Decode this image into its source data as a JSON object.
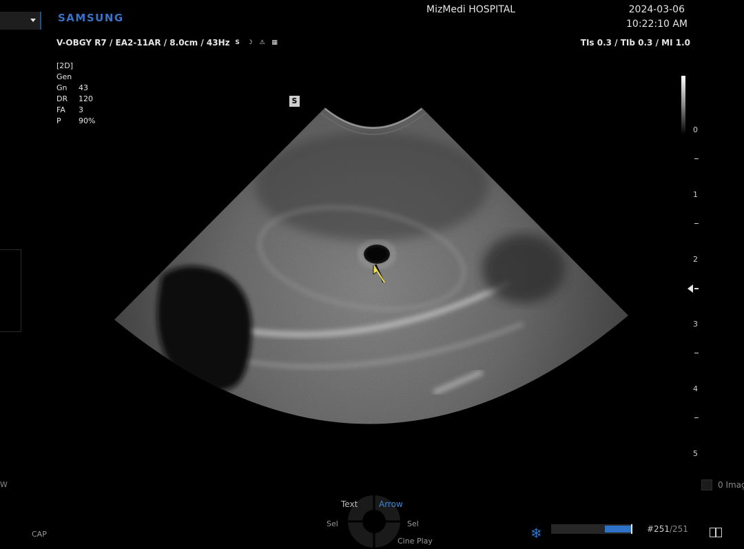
{
  "header": {
    "brand": "SAMSUNG",
    "hospital": "MizMedi HOSPITAL",
    "date": "2024-03-06",
    "time": "10:22:10 AM",
    "probe_info": "V-OBGY R7 / EA2-11AR / 8.0cm / 43Hz",
    "safety_info": "TIs  0.3 / TIb  0.3 / MI    1.0",
    "status_icons": [
      "s-mark-icon",
      "fetus-icon",
      "warning-icon",
      "chart-icon"
    ]
  },
  "params": {
    "mode": "[2D]",
    "preset": "Gen",
    "rows": [
      {
        "key": "Gn",
        "value": "43"
      },
      {
        "key": "DR",
        "value": "120"
      },
      {
        "key": "FA",
        "value": "3"
      },
      {
        "key": "P",
        "value": "90%"
      }
    ]
  },
  "image_marker": "S",
  "depth_scale": {
    "unit": "cm",
    "labels": [
      "0",
      "1",
      "2",
      "3",
      "4",
      "5"
    ]
  },
  "image_count": "0 Imag",
  "side_letter": "W",
  "softkeys": {
    "text": "Text",
    "arrow": "Arrow",
    "sel_left": "Sel",
    "sel_right": "Sel",
    "cine_play": "Cine Play"
  },
  "cap_label": "CAP",
  "cine": {
    "current_frame": "#251",
    "total_frames": "/251",
    "progress": 1.0
  },
  "colors": {
    "brand": "#3a72c8",
    "active_softkey": "#3d86d6",
    "cine_fill": "#2f73c8",
    "arrow_annotation": "#f2e14a"
  }
}
